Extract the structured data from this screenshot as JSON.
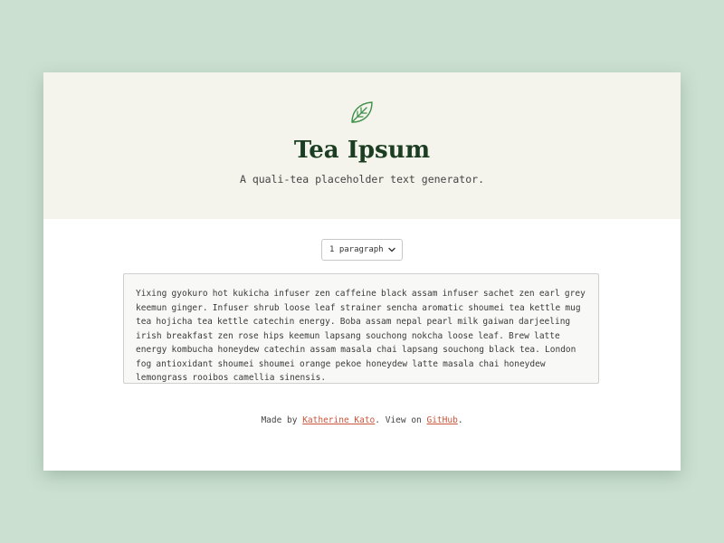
{
  "header": {
    "icon": "leaf-icon",
    "title": "Tea Ipsum",
    "subtitle": "A quali-tea placeholder text generator."
  },
  "controls": {
    "paragraph_select": {
      "selected": "1 paragraph"
    }
  },
  "output": {
    "text": "Yixing gyokuro hot kukicha infuser zen caffeine black assam infuser sachet zen earl grey keemun ginger. Infuser shrub loose leaf strainer sencha aromatic shoumei tea kettle mug tea hojicha tea kettle catechin energy. Boba assam nepal pearl milk gaiwan darjeeling irish breakfast zen rose hips keemun lapsang souchong nokcha loose leaf. Brew latte energy kombucha honeydew catechin assam masala chai lapsang souchong black tea. London fog antioxidant shoumei shoumei orange pekoe honeydew latte masala chai honeydew lemongrass rooibos camellia sinensis."
  },
  "footer": {
    "made_by_prefix": "Made by ",
    "author_link": "Katherine Kato",
    "view_on_text": ". View on ",
    "github_link": "GitHub",
    "suffix": "."
  },
  "colors": {
    "page_background": "#cbe0d1",
    "hero_background": "#f4f4ec",
    "title": "#1b3d22",
    "leaf_icon": "#3f8f4a",
    "link": "#c9553a"
  }
}
